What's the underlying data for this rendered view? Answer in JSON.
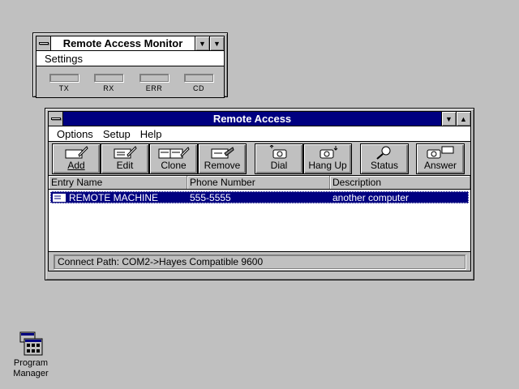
{
  "monitor": {
    "title": "Remote Access Monitor",
    "menu": {
      "settings": "Settings"
    },
    "indicators": [
      "TX",
      "RX",
      "ERR",
      "CD"
    ]
  },
  "main": {
    "title": "Remote Access",
    "menu": {
      "options": "Options",
      "setup": "Setup",
      "help": "Help"
    },
    "toolbar": {
      "add": "Add",
      "edit": "Edit",
      "clone": "Clone",
      "remove": "Remove",
      "dial": "Dial",
      "hang_up": "Hang Up",
      "status": "Status",
      "answer": "Answer"
    },
    "columns": {
      "entry_name": "Entry Name",
      "phone_number": "Phone Number",
      "description": "Description"
    },
    "entries": [
      {
        "name": "REMOTE MACHINE",
        "phone": "555-5555",
        "description": "another computer"
      }
    ],
    "status": "Connect Path:  COM2->Hayes Compatible 9600"
  },
  "desktop": {
    "program_manager": "Program Manager"
  },
  "colors": {
    "desktop": "#c0c0c0",
    "active_title": "#000080",
    "selection": "#000080"
  }
}
